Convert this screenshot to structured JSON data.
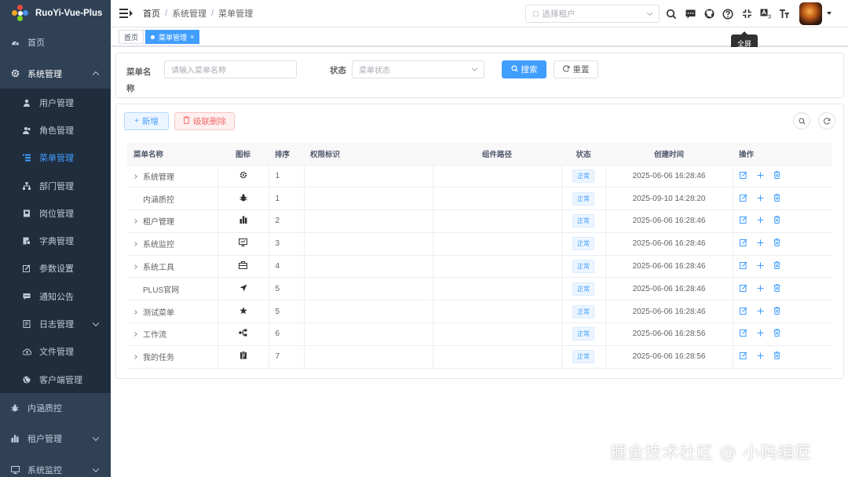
{
  "app": {
    "title": "RuoYi-Vue-Plus"
  },
  "sidebar": {
    "items": [
      {
        "label": "首页",
        "icon": "dashboard-icon"
      },
      {
        "label": "系统管理",
        "icon": "gear-icon",
        "expanded": true,
        "children": [
          {
            "label": "用户管理",
            "icon": "user-icon"
          },
          {
            "label": "角色管理",
            "icon": "peoples-icon"
          },
          {
            "label": "菜单管理",
            "icon": "tree-table-icon",
            "active": true
          },
          {
            "label": "部门管理",
            "icon": "tree-icon"
          },
          {
            "label": "岗位管理",
            "icon": "post-icon"
          },
          {
            "label": "字典管理",
            "icon": "dict-icon"
          },
          {
            "label": "参数设置",
            "icon": "edit-icon"
          },
          {
            "label": "通知公告",
            "icon": "message-icon"
          },
          {
            "label": "日志管理",
            "icon": "log-icon",
            "has_arrow": true
          },
          {
            "label": "文件管理",
            "icon": "upload-icon"
          },
          {
            "label": "客户端管理",
            "icon": "international-icon"
          }
        ]
      },
      {
        "label": "内涵质控",
        "icon": "bug-icon"
      },
      {
        "label": "租户管理",
        "icon": "chart-icon",
        "has_arrow": true
      },
      {
        "label": "系统监控",
        "icon": "monitor-icon",
        "has_arrow": true
      }
    ]
  },
  "navbar": {
    "breadcrumb": [
      "首页",
      "系统管理",
      "菜单管理"
    ],
    "tenant_placeholder": "选择租户",
    "tooltip": "全屏"
  },
  "tags": {
    "home": "首页",
    "active": "菜单管理"
  },
  "search": {
    "name_label": "菜单名称",
    "name_placeholder": "请输入菜单名称",
    "status_label": "状态",
    "status_placeholder": "菜单状态",
    "search_button": "搜索",
    "reset_button": "重置"
  },
  "toolbar": {
    "add_button": "新增",
    "cascade_delete_button": "级联删除"
  },
  "table": {
    "columns": [
      "菜单名称",
      "图标",
      "排序",
      "权限标识",
      "组件路径",
      "状态",
      "创建时间",
      "操作"
    ],
    "rows": [
      {
        "name": "系统管理",
        "expandable": true,
        "icon": "gear-icon",
        "order": "1",
        "perms": "",
        "component": "",
        "status": "正常",
        "created": "2025-06-06 16:28:46"
      },
      {
        "name": "内涵质控",
        "expandable": false,
        "icon": "bug-icon",
        "order": "1",
        "perms": "",
        "component": "",
        "status": "正常",
        "created": "2025-09-10 14:28:20"
      },
      {
        "name": "租户管理",
        "expandable": true,
        "icon": "chart-icon",
        "order": "2",
        "perms": "",
        "component": "",
        "status": "正常",
        "created": "2025-06-06 16:28:46"
      },
      {
        "name": "系统监控",
        "expandable": true,
        "icon": "monitor-icon",
        "order": "3",
        "perms": "",
        "component": "",
        "status": "正常",
        "created": "2025-06-06 16:28:46"
      },
      {
        "name": "系统工具",
        "expandable": true,
        "icon": "toolbox-icon",
        "order": "4",
        "perms": "",
        "component": "",
        "status": "正常",
        "created": "2025-06-06 16:28:46"
      },
      {
        "name": "PLUS官网",
        "expandable": false,
        "icon": "guide-icon",
        "order": "5",
        "perms": "",
        "component": "",
        "status": "正常",
        "created": "2025-06-06 16:28:46"
      },
      {
        "name": "测试菜单",
        "expandable": true,
        "icon": "star-icon",
        "order": "5",
        "perms": "",
        "component": "",
        "status": "正常",
        "created": "2025-06-06 16:28:46"
      },
      {
        "name": "工作流",
        "expandable": true,
        "icon": "workflow-icon",
        "order": "6",
        "perms": "",
        "component": "",
        "status": "正常",
        "created": "2025-06-06 16:28:56"
      },
      {
        "name": "我的任务",
        "expandable": true,
        "icon": "my-task-icon",
        "order": "7",
        "perms": "",
        "component": "",
        "status": "正常",
        "created": "2025-06-06 16:28:56"
      }
    ]
  },
  "watermark": "掘金技术社区 @ 小码编匠",
  "colors": {
    "sidebar_bg": "#304156",
    "sidebar_sub_bg": "#1f2d3d",
    "primary": "#409eff",
    "danger": "#f56c6c"
  }
}
